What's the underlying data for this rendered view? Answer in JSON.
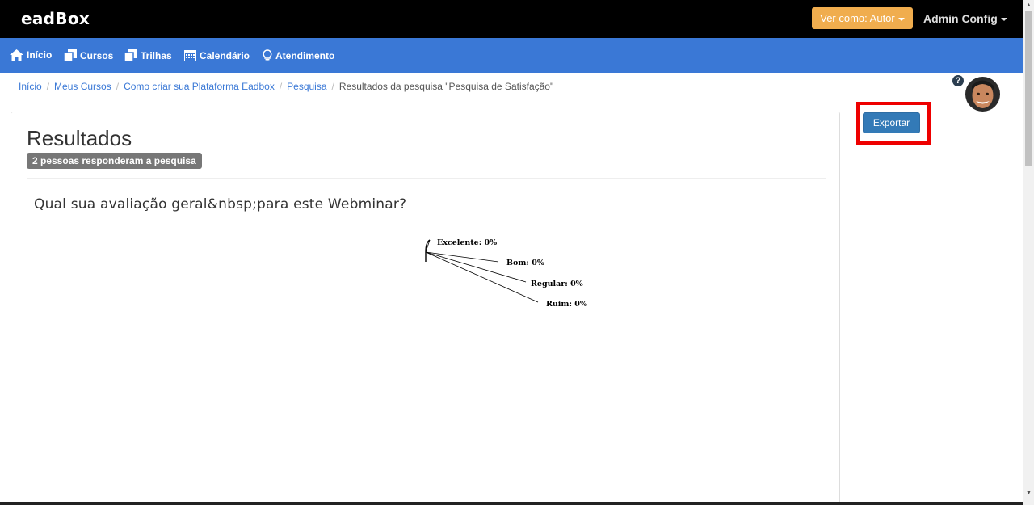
{
  "app": {
    "logo": "eadBox"
  },
  "topbar": {
    "view_as": "Ver como: Autor",
    "admin_config": "Admin Config"
  },
  "nav": {
    "items": [
      {
        "label": "Início",
        "icon": "home-icon"
      },
      {
        "label": "Cursos",
        "icon": "copy-icon"
      },
      {
        "label": "Trilhas",
        "icon": "copy-icon"
      },
      {
        "label": "Calendário",
        "icon": "calendar-icon"
      },
      {
        "label": "Atendimento",
        "icon": "lightbulb-icon"
      }
    ]
  },
  "breadcrumb": {
    "items": [
      "Início",
      "Meus Cursos",
      "Como criar sua Plataforma Eadbox",
      "Pesquisa"
    ],
    "current": "Resultados da pesquisa \"Pesquisa de Satisfação\""
  },
  "panel": {
    "title": "Resultados",
    "badge": "2 pessoas responderam a pesquisa",
    "question": "Qual sua avaliação geral&nbsp;para este Webminar?"
  },
  "chart_data": {
    "type": "pie",
    "categories": [
      "Excelente",
      "Bom",
      "Regular",
      "Ruim"
    ],
    "values": [
      0,
      0,
      0,
      0
    ],
    "labels": [
      "Excelente: 0%",
      "Bom: 0%",
      "Regular: 0%",
      "Ruim: 0%"
    ]
  },
  "actions": {
    "export": "Exportar"
  },
  "colors": {
    "nav_bg": "#3a78d6",
    "view_as_bg": "#f0ad4e",
    "export_bg": "#337ab7",
    "highlight": "#ee0000"
  }
}
